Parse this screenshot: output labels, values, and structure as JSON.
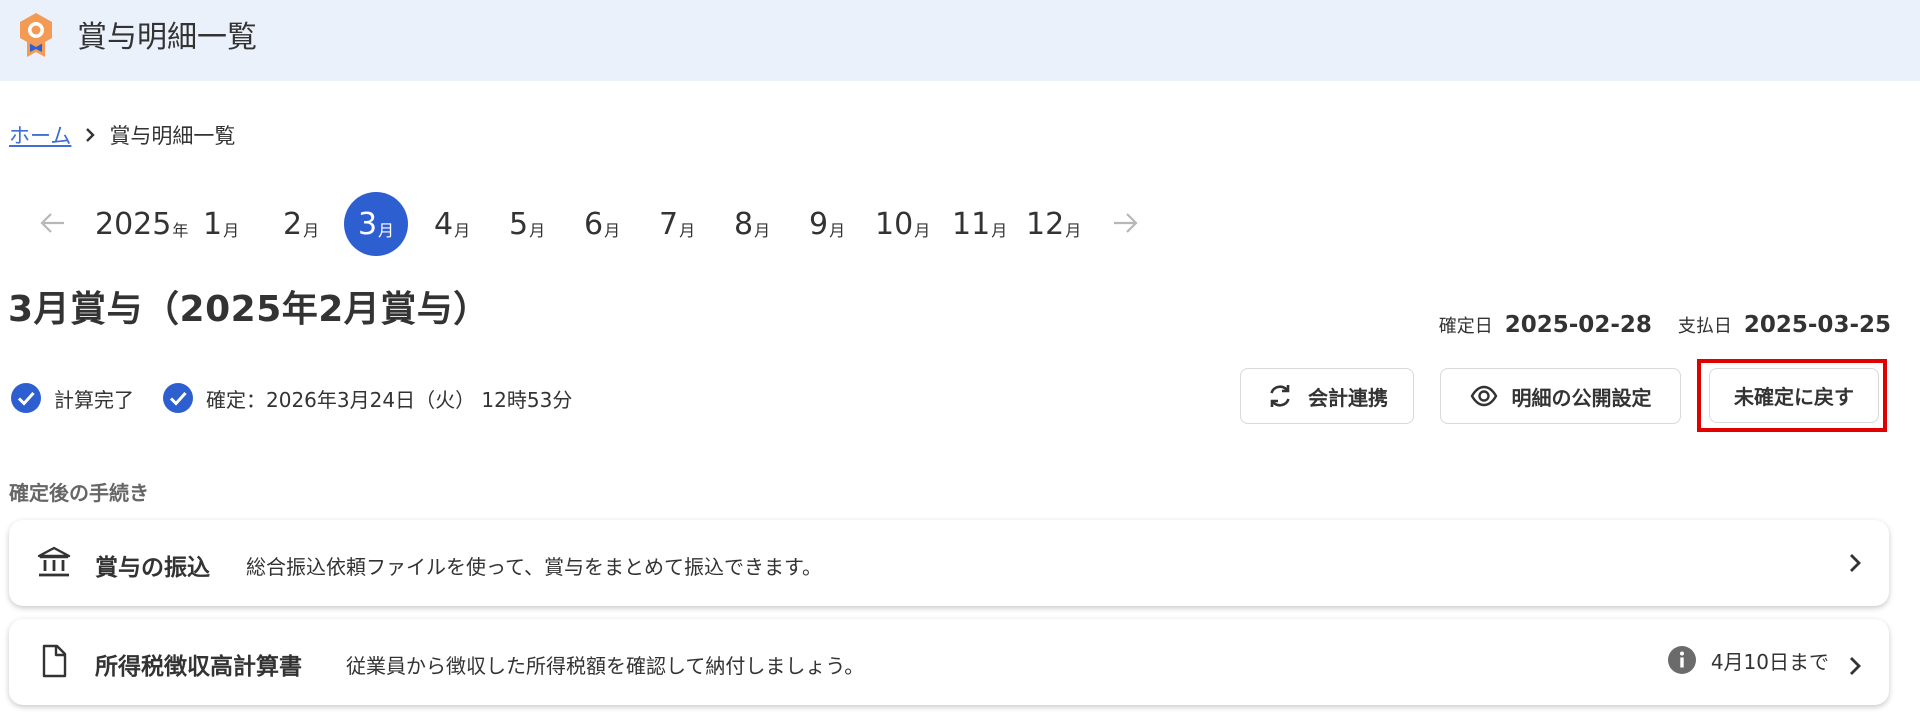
{
  "header": {
    "title": "賞与明細一覧",
    "icon": "medal-icon",
    "accent": "#f39a55"
  },
  "breadcrumb": {
    "home": "ホーム",
    "current": "賞与明細一覧"
  },
  "month_nav": {
    "year": "2025",
    "year_unit": "年",
    "month_unit": "月",
    "months": [
      "1",
      "2",
      "3",
      "4",
      "5",
      "6",
      "7",
      "8",
      "9",
      "10",
      "11",
      "12"
    ],
    "selected": "3",
    "active_color": "#2e5fd0"
  },
  "page_title": "3月賞与（2025年2月賞与）",
  "dates": {
    "confirm_label": "確定日",
    "confirm_value": "2025-02-28",
    "pay_label": "支払日",
    "pay_value": "2025-03-25"
  },
  "status": {
    "calc_done": "計算完了",
    "confirmed": "確定：2026年3月24日（火） 12時53分"
  },
  "buttons": {
    "accounting": "会計連携",
    "publish": "明細の公開設定",
    "unconfirm": "未確定に戻す"
  },
  "section_label": "確定後の手続き",
  "cards": [
    {
      "title": "賞与の振込",
      "desc": "総合振込依頼ファイルを使って、賞与をまとめて振込できます。",
      "icon": "bank-icon"
    },
    {
      "title": "所得税徴収高計算書",
      "desc": "従業員から徴収した所得税額を確認して納付しましょう。",
      "icon": "document-icon",
      "deadline": "4月10日まで"
    }
  ],
  "colors": {
    "check": "#2e5fd0",
    "highlight": "#e10000",
    "link": "#3f6fd1"
  }
}
